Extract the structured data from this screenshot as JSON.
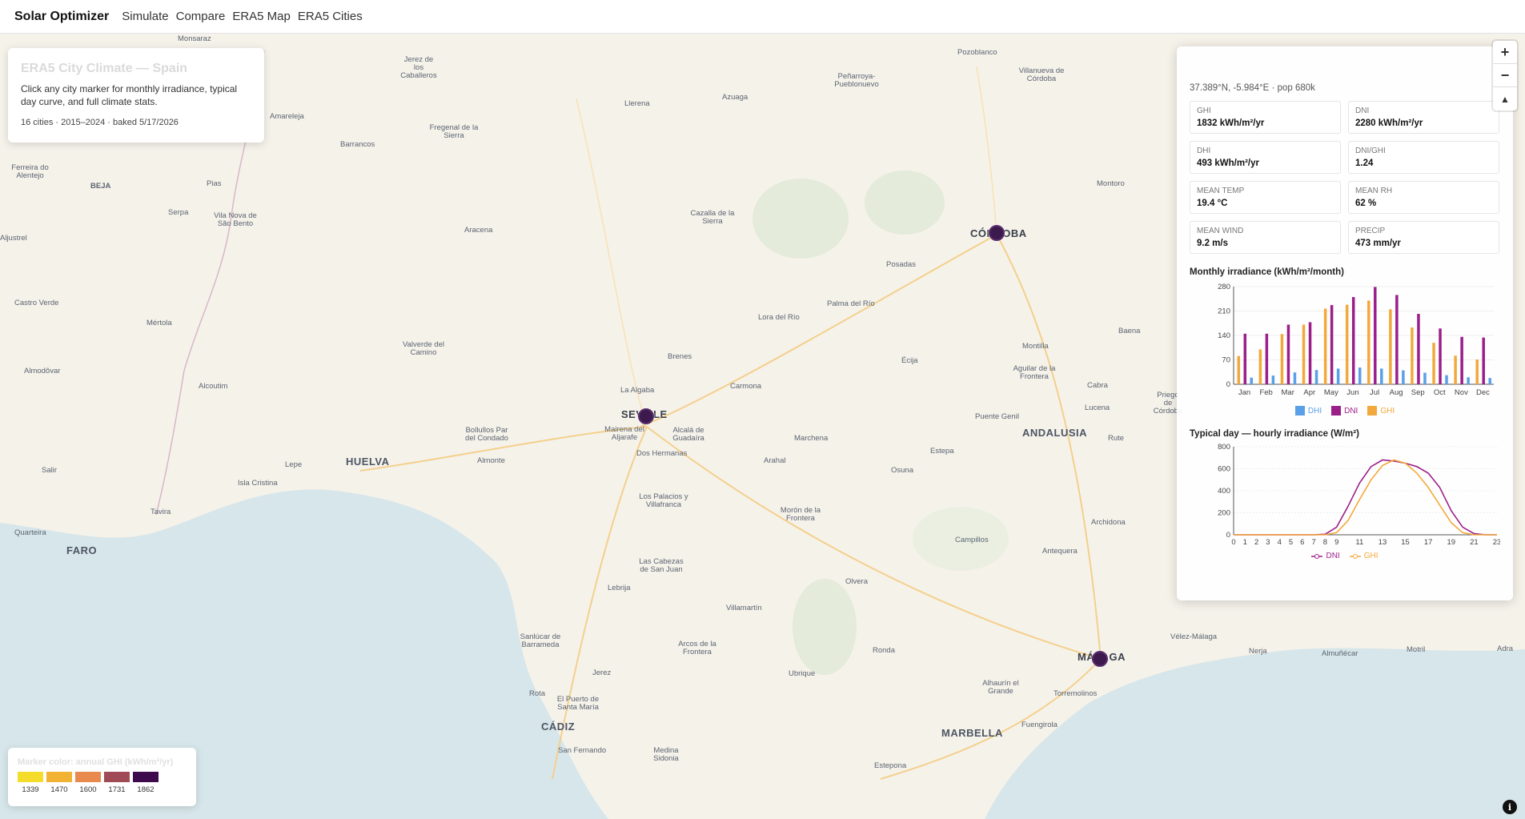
{
  "nav": {
    "brand": "Solar Optimizer",
    "links": [
      "Simulate",
      "Compare",
      "ERA5 Map",
      "ERA5 Cities"
    ]
  },
  "info_card": {
    "title": "ERA5 City Climate — Spain",
    "description": "Click any city marker for monthly irradiance, typical day curve, and full climate stats.",
    "meta": "16 cities · 2015–2024 · baked 5/17/2026"
  },
  "zoom": {
    "in": "+",
    "out": "−",
    "compass": "▲"
  },
  "map": {
    "labels": [
      "Monsaraz",
      "Jerez de los Caballeros",
      "Amareleja",
      "Llerena",
      "Azuaga",
      "Peñarroya-Pueblonuevo",
      "Pozoblanco",
      "Villanueva de Córdoba",
      "Fregenal de la Sierra",
      "Barrancos",
      "Ferreira do Alentejo",
      "BEJA",
      "Pias",
      "Serpa",
      "Vila Nova de São Bento",
      "Cazalla de la Sierra",
      "Aljustrel",
      "Aracena",
      "Montoro",
      "Posadas",
      "Castro Verde",
      "Mértola",
      "Lora del Río",
      "Palma del Río",
      "Baena",
      "Almodôvar",
      "Valverde del Camino",
      "Brenes",
      "Montilla",
      "Écija",
      "Alcoutim",
      "Carmona",
      "Aguilar de la Frontera",
      "Cabra",
      "Priego de Córdoba",
      "La Algaba",
      "Mairena del Aljarafe",
      "Alcalá de Guadaíra",
      "Bollullos Par del Condado",
      "Lucena",
      "Puente Genil",
      "ANDALUSIA",
      "Marchena",
      "Rute",
      "Salir",
      "Almonte",
      "Dos Hermanas",
      "Estepa",
      "Osuna",
      "Arahal",
      "Lepe",
      "HUELVA",
      "Isla Cristina",
      "Tavira",
      "Los Palacios y Villafranca",
      "Morón de la Frontera",
      "Archidona",
      "Quarteira",
      "FARO",
      "Campillos",
      "Antequera",
      "Las Cabezas de San Juan",
      "Lebrija",
      "Olvera",
      "Villamartín",
      "Vélez-Málaga",
      "Nerja",
      "Almuñécar",
      "Motril",
      "Adra",
      "Sanlúcar de Barrameda",
      "Arcos de la Frontera",
      "Ronda",
      "Ubrique",
      "Alhaurín el Grande",
      "Torremolinos",
      "Jerez",
      "Rota",
      "El Puerto de Santa María",
      "Fuengirola",
      "CÁDIZ",
      "MARBELLA",
      "San Fernando",
      "Medina Sidonia",
      "Estepona"
    ],
    "cities": [
      "CÓRDOBA",
      "SEVILLE",
      "MÁLAGA"
    ]
  },
  "panel": {
    "close": "×",
    "coords": "37.389°N, -5.984°E · pop 680k",
    "stats": [
      {
        "label": "GHI",
        "value": "1832 kWh/m²/yr"
      },
      {
        "label": "DNI",
        "value": "2280 kWh/m²/yr"
      },
      {
        "label": "DHI",
        "value": "493 kWh/m²/yr"
      },
      {
        "label": "DNI/GHI",
        "value": "1.24"
      },
      {
        "label": "Mean temp",
        "value": "19.4 °C"
      },
      {
        "label": "Mean RH",
        "value": "62 %"
      },
      {
        "label": "Mean wind",
        "value": "9.2 m/s"
      },
      {
        "label": "Precip",
        "value": "473 mm/yr"
      }
    ],
    "monthly_title": "Monthly irradiance (kWh/m²/month)",
    "hourly_title": "Typical day — hourly irradiance (W/m²)"
  },
  "colors": {
    "dhi": "#5aa0e8",
    "dni": "#9b1f8a",
    "ghi": "#f2a93b",
    "marker": "#3d1a4d"
  },
  "chart_data": [
    {
      "type": "bar",
      "title": "Monthly irradiance (kWh/m²/month)",
      "categories": [
        "Jan",
        "Feb",
        "Mar",
        "Apr",
        "May",
        "Jun",
        "Jul",
        "Aug",
        "Sep",
        "Oct",
        "Nov",
        "Dec"
      ],
      "ylim": [
        0,
        280
      ],
      "yticks": [
        0,
        70,
        140,
        210,
        280
      ],
      "series": [
        {
          "name": "DHI",
          "values": [
            19,
            25,
            34,
            41,
            45,
            48,
            45,
            40,
            33,
            26,
            20,
            18
          ]
        },
        {
          "name": "DNI",
          "values": [
            145,
            145,
            171,
            178,
            227,
            250,
            279,
            256,
            202,
            160,
            136,
            134
          ]
        },
        {
          "name": "GHI",
          "values": [
            81,
            100,
            144,
            171,
            217,
            228,
            240,
            215,
            163,
            119,
            82,
            71
          ]
        }
      ],
      "legend": [
        "DHI",
        "DNI",
        "GHI"
      ]
    },
    {
      "type": "line",
      "title": "Typical day — hourly irradiance (W/m²)",
      "x": [
        0,
        1,
        2,
        3,
        4,
        5,
        6,
        7,
        8,
        9,
        10,
        11,
        12,
        13,
        14,
        15,
        16,
        17,
        18,
        19,
        20,
        21,
        22,
        23
      ],
      "xticks": [
        0,
        1,
        2,
        3,
        4,
        5,
        6,
        7,
        8,
        9,
        11,
        13,
        15,
        17,
        19,
        21,
        23
      ],
      "ylim": [
        0,
        800
      ],
      "yticks": [
        0,
        200,
        400,
        600,
        800
      ],
      "series": [
        {
          "name": "DNI",
          "values": [
            0,
            0,
            0,
            0,
            0,
            0,
            0,
            0,
            5,
            70,
            260,
            470,
            620,
            680,
            670,
            650,
            620,
            560,
            430,
            220,
            70,
            10,
            0,
            0
          ]
        },
        {
          "name": "GHI",
          "values": [
            0,
            0,
            0,
            0,
            0,
            0,
            0,
            0,
            0,
            20,
            130,
            320,
            500,
            630,
            680,
            650,
            560,
            430,
            270,
            110,
            20,
            0,
            0,
            0
          ]
        }
      ],
      "legend": [
        "DNI",
        "GHI"
      ]
    }
  ],
  "color_legend": {
    "title": "Marker color: annual GHI (kWh/m²/yr)",
    "stops": [
      {
        "label": "1339",
        "color": "#f5dc2a"
      },
      {
        "label": "1470",
        "color": "#f2b233"
      },
      {
        "label": "1600",
        "color": "#e88a4d"
      },
      {
        "label": "1731",
        "color": "#a04a55"
      },
      {
        "label": "1862",
        "color": "#3d0a4d"
      }
    ]
  },
  "attribution": "i"
}
